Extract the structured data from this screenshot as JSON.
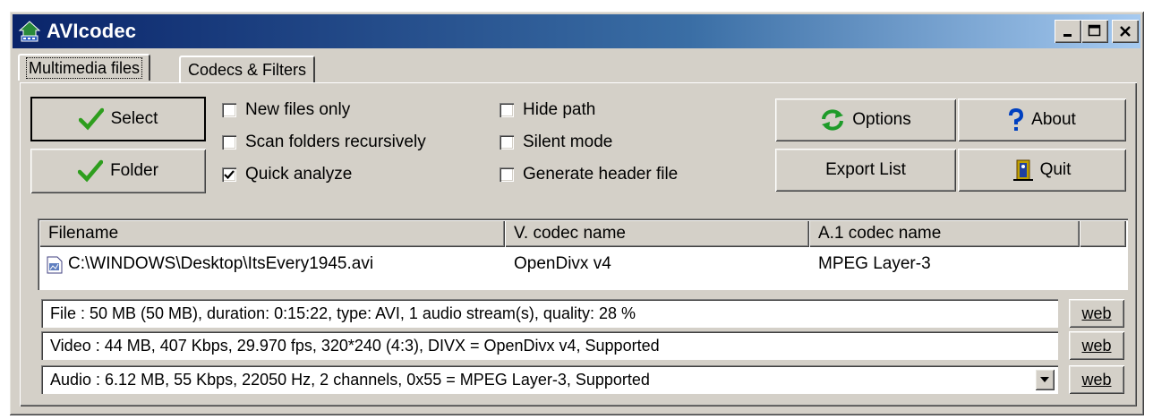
{
  "window": {
    "title": "AVIcodec"
  },
  "colors": {
    "title_start": "#0a246a",
    "title_end": "#a6caf0",
    "face": "#d4d0c8",
    "check_green": "#2e9e1e",
    "options_green": "#1e9b2a",
    "about_blue": "#0040c0"
  },
  "tabs": [
    {
      "label": "Multimedia files",
      "active": true
    },
    {
      "label": "Codecs & Filters",
      "active": false
    }
  ],
  "buttons": {
    "select": "Select",
    "folder": "Folder",
    "options": "Options",
    "about": "About",
    "export": "Export List",
    "quit": "Quit"
  },
  "checkboxes": {
    "new_files_only": {
      "label": "New files only",
      "checked": false
    },
    "scan_recursive": {
      "label": "Scan folders recursively",
      "checked": false
    },
    "quick_analyze": {
      "label": "Quick analyze",
      "checked": true
    },
    "hide_path": {
      "label": "Hide path",
      "checked": false
    },
    "silent_mode": {
      "label": "Silent mode",
      "checked": false
    },
    "generate_header": {
      "label": "Generate header file",
      "checked": false
    }
  },
  "table": {
    "columns": [
      "Filename",
      "V. codec name",
      "A.1 codec name"
    ],
    "rows": [
      {
        "filename": "C:\\WINDOWS\\Desktop\\ItsEvery1945.avi",
        "vcodec": "OpenDivx v4",
        "acodec": "MPEG Layer-3"
      }
    ]
  },
  "info": {
    "file": "File   :  50 MB (50 MB),  duration: 0:15:22,  type: AVI,  1 audio stream(s),  quality: 28 %",
    "video": "Video :  44 MB,  407 Kbps,  29.970 fps,  320*240 (4:3),  DIVX = OpenDivx v4,    Supported",
    "audio": "Audio :  6.12 MB,  55 Kbps,  22050 Hz,  2 channels,  0x55 = MPEG Layer-3,    Supported",
    "web_label": "web"
  },
  "icons": [
    "app-icon",
    "minimize-icon",
    "maximize-icon",
    "close-icon",
    "checkmark-icon",
    "refresh-icon",
    "question-icon",
    "exit-door-icon",
    "file-icon",
    "dropdown-arrow-icon"
  ]
}
